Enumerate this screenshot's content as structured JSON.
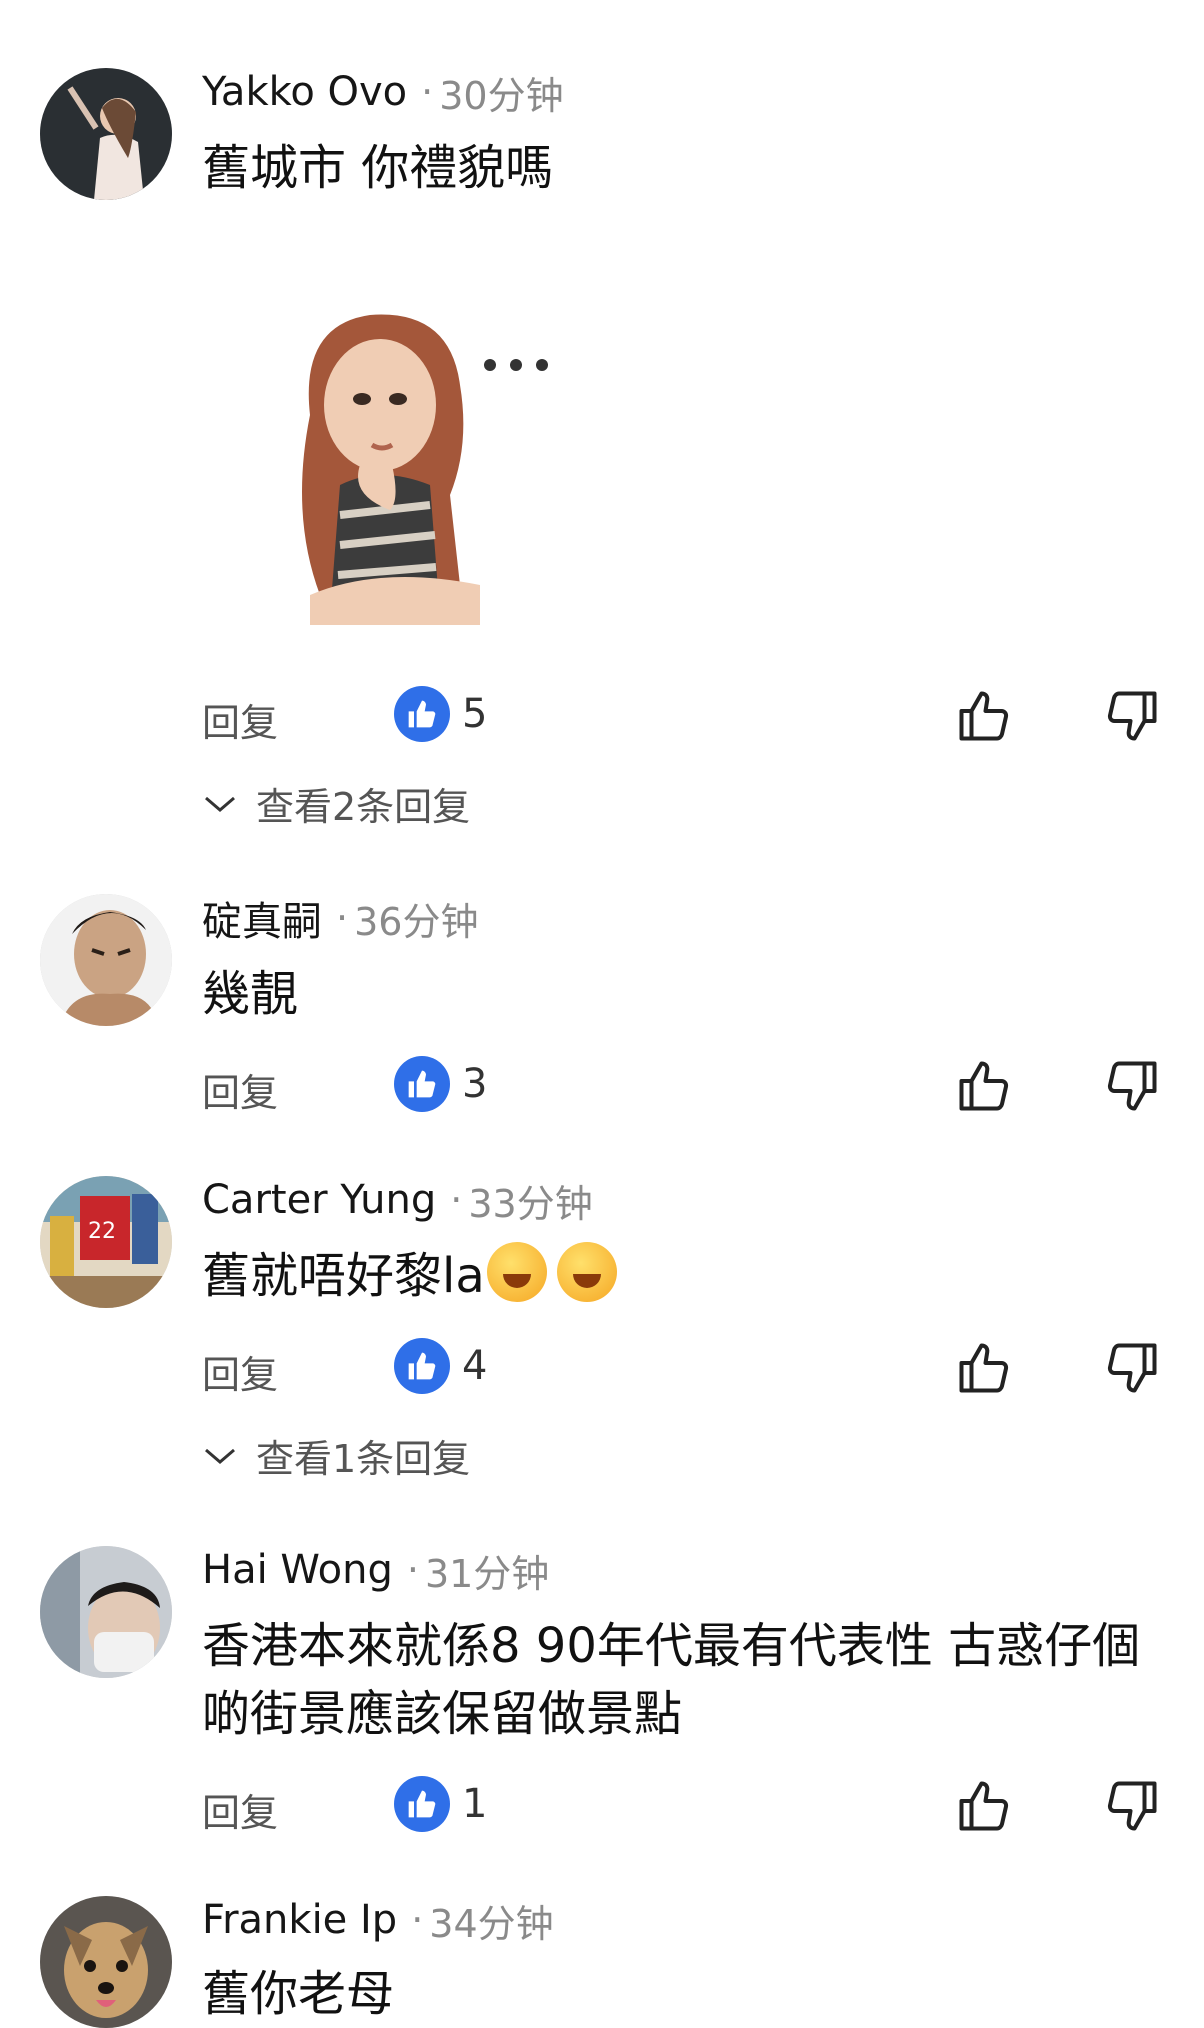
{
  "comments": [
    {
      "author": "Yakko Ovo",
      "time": "30分钟",
      "text": "舊城市 你禮貌嗎",
      "has_sticker": true,
      "reply_label": "回复",
      "likes": "5",
      "view_replies": "查看2条回复"
    },
    {
      "author": "碇真嗣",
      "time": "36分钟",
      "text": "幾靚",
      "reply_label": "回复",
      "likes": "3"
    },
    {
      "author": "Carter Yung",
      "time": "33分钟",
      "text": "舊就唔好黎la",
      "emoji": [
        "rolling-laughing-emoji",
        "rolling-laughing-emoji"
      ],
      "reply_label": "回复",
      "likes": "4",
      "view_replies": "查看1条回复"
    },
    {
      "author": "Hai Wong",
      "time": "31分钟",
      "text": "香港本來就係8 90年代最有代表性 古惑仔個啲街景應該保留做景點",
      "reply_label": "回复",
      "likes": "1"
    },
    {
      "author": "Frankie Ip",
      "time": "34分钟",
      "text": "舊你老母"
    }
  ],
  "separator": "·",
  "colors": {
    "like_badge": "#2f6fe8",
    "secondary_text": "#8a8a8a"
  }
}
